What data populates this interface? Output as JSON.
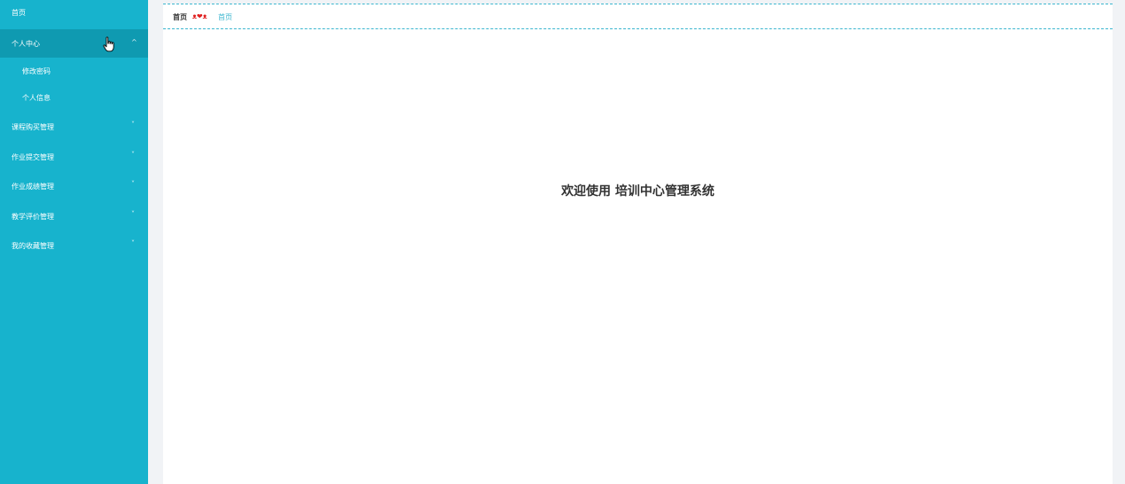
{
  "sidebar": {
    "items": [
      {
        "label": "首页"
      },
      {
        "label": "个人中心",
        "chevron": "^"
      },
      {
        "label": "课程购买管理",
        "chevron": "˅"
      },
      {
        "label": "作业提交管理",
        "chevron": "˅"
      },
      {
        "label": "作业成绩管理",
        "chevron": "˅"
      },
      {
        "label": "教学评价管理",
        "chevron": "˅"
      },
      {
        "label": "我的收藏管理",
        "chevron": "˅"
      }
    ],
    "sub_items": [
      {
        "label": "修改密码"
      },
      {
        "label": "个人信息"
      }
    ]
  },
  "breadcrumb": {
    "home": "首页",
    "separator": "ᴥ❤ᴥ",
    "current": "首页"
  },
  "main": {
    "welcome_text": "欢迎使用 培训中心管理系统"
  },
  "colors": {
    "sidebar_bg": "#17b3cd",
    "sidebar_active_bg": "#0f9ab1",
    "accent": "#3bb6cf",
    "separator_red": "#e02020"
  }
}
